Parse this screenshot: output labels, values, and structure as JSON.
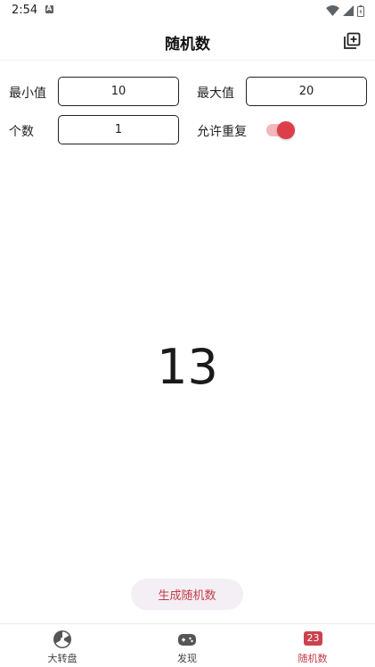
{
  "status_bar": {
    "time": "2:54"
  },
  "app_bar": {
    "title": "随机数"
  },
  "form": {
    "min_label": "最小值",
    "min_value": "10",
    "max_label": "最大值",
    "max_value": "20",
    "count_label": "个数",
    "count_value": "1",
    "allow_repeat_label": "允许重复",
    "allow_repeat": true
  },
  "result": {
    "value": "13"
  },
  "generate_button": {
    "label": "生成随机数"
  },
  "bottom_nav": {
    "items": [
      {
        "label": "大转盘",
        "icon": "wheel-icon",
        "active": false
      },
      {
        "label": "发现",
        "icon": "gamepad-icon",
        "active": false
      },
      {
        "label": "随机数",
        "icon": "number-23-icon",
        "badge": "23",
        "active": true
      }
    ]
  },
  "colors": {
    "accent": "#c43a46",
    "switch_thumb": "#dd3f4a",
    "switch_track": "#f4b7bc",
    "button_bg": "#f3eff4"
  }
}
